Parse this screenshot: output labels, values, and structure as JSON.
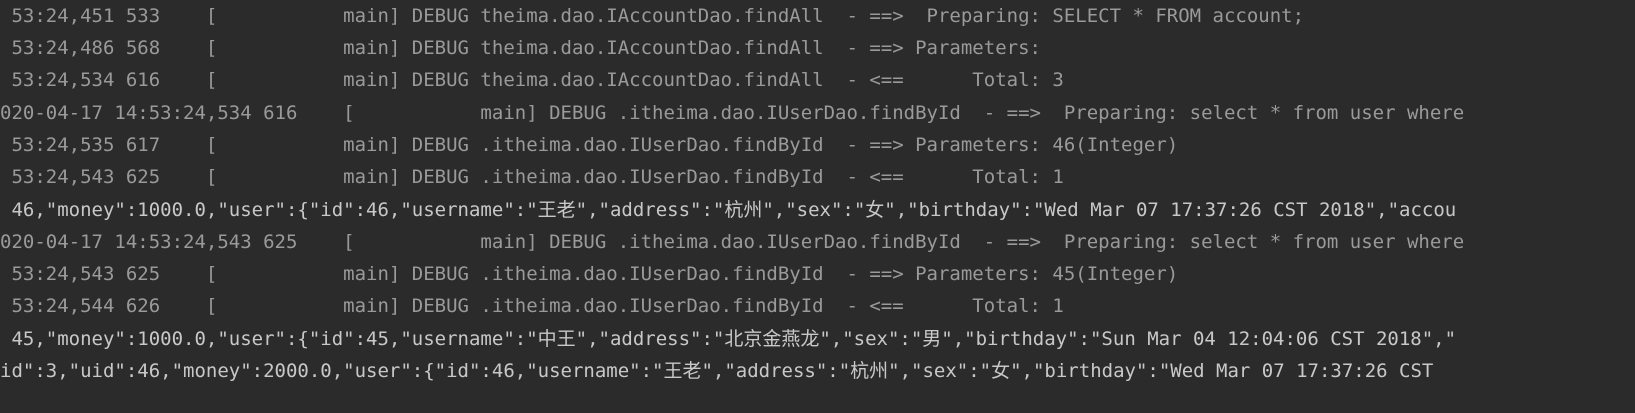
{
  "console": {
    "lines": [
      {
        "text": " 53:24,451 533    [           main] DEBUG theima.dao.IAccountDao.findAll  - ==>  Preparing: SELECT * FROM account;",
        "kind": "debug"
      },
      {
        "text": " 53:24,486 568    [           main] DEBUG theima.dao.IAccountDao.findAll  - ==> Parameters: ",
        "kind": "debug"
      },
      {
        "text": " 53:24,534 616    [           main] DEBUG theima.dao.IAccountDao.findAll  - <==      Total: 3",
        "kind": "debug"
      },
      {
        "text": "020-04-17 14:53:24,534 616    [           main] DEBUG .itheima.dao.IUserDao.findById  - ==>  Preparing: select * from user where",
        "kind": "debug"
      },
      {
        "text": " 53:24,535 617    [           main] DEBUG .itheima.dao.IUserDao.findById  - ==> Parameters: 46(Integer)",
        "kind": "debug"
      },
      {
        "text": " 53:24,543 625    [           main] DEBUG .itheima.dao.IUserDao.findById  - <==      Total: 1",
        "kind": "debug"
      },
      {
        "text": " 46,\"money\":1000.0,\"user\":{\"id\":46,\"username\":\"王老\",\"address\":\"杭州\",\"sex\":\"女\",\"birthday\":\"Wed Mar 07 17:37:26 CST 2018\",\"accou",
        "kind": "output"
      },
      {
        "text": "020-04-17 14:53:24,543 625    [           main] DEBUG .itheima.dao.IUserDao.findById  - ==>  Preparing: select * from user where",
        "kind": "debug"
      },
      {
        "text": " 53:24,543 625    [           main] DEBUG .itheima.dao.IUserDao.findById  - ==> Parameters: 45(Integer)",
        "kind": "debug"
      },
      {
        "text": " 53:24,544 626    [           main] DEBUG .itheima.dao.IUserDao.findById  - <==      Total: 1",
        "kind": "debug"
      },
      {
        "text": " 45,\"money\":1000.0,\"user\":{\"id\":45,\"username\":\"中王\",\"address\":\"北京金燕龙\",\"sex\":\"男\",\"birthday\":\"Sun Mar 04 12:04:06 CST 2018\",\"",
        "kind": "output"
      },
      {
        "text": "id\":3,\"uid\":46,\"money\":2000.0,\"user\":{\"id\":46,\"username\":\"王老\",\"address\":\"杭州\",\"sex\":\"女\",\"birthday\":\"Wed Mar 07 17:37:26 CST",
        "kind": "output"
      }
    ]
  }
}
